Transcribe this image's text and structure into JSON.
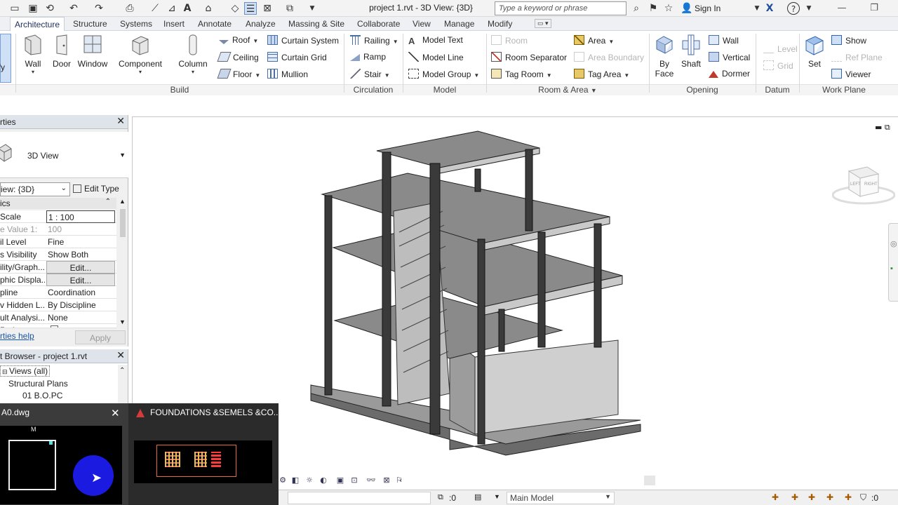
{
  "app": {
    "title": "project 1.rvt - 3D View: {3D}",
    "search_placeholder": "Type a keyword or phrase",
    "sign_in": "Sign In",
    "help": "?"
  },
  "ribbon_tabs": [
    {
      "label": "Architecture",
      "active": true
    },
    {
      "label": "Structure"
    },
    {
      "label": "Systems"
    },
    {
      "label": "Insert"
    },
    {
      "label": "Annotate"
    },
    {
      "label": "Analyze"
    },
    {
      "label": "Massing & Site"
    },
    {
      "label": "Collaborate"
    },
    {
      "label": "View"
    },
    {
      "label": "Manage"
    },
    {
      "label": "Modify"
    }
  ],
  "ribbon": {
    "modify": "ify",
    "build": {
      "title": "Build",
      "wall": "Wall",
      "door": "Door",
      "window": "Window",
      "component": "Component",
      "column": "Column",
      "roof": "Roof",
      "ceiling": "Ceiling",
      "floor": "Floor",
      "curtain_system": "Curtain System",
      "curtain_grid": "Curtain Grid",
      "mullion": "Mullion"
    },
    "circulation": {
      "title": "Circulation",
      "railing": "Railing",
      "ramp": "Ramp",
      "stair": "Stair"
    },
    "model": {
      "title": "Model",
      "model_text": "Model Text",
      "model_line": "Model Line",
      "model_group": "Model Group"
    },
    "room_area": {
      "title": "Room & Area",
      "room": "Room",
      "room_separator": "Room Separator",
      "tag_room": "Tag Room",
      "area": "Area",
      "area_boundary": "Area Boundary",
      "tag_area": "Tag Area"
    },
    "opening": {
      "title": "Opening",
      "by_face_1": "By",
      "by_face_2": "Face",
      "shaft": "Shaft",
      "wall": "Wall",
      "vertical": "Vertical",
      "dormer": "Dormer"
    },
    "datum": {
      "title": "Datum",
      "level": "Level",
      "grid": "Grid"
    },
    "work_plane": {
      "title": "Work Plane",
      "set": "Set",
      "show": "Show",
      "ref_plane": "Ref  Plane",
      "viewer": "Viewer"
    }
  },
  "properties": {
    "title": "rties",
    "type_name": "3D View",
    "view_selector": "iew: {3D}",
    "edit_type": "Edit Type",
    "group": "ics",
    "rows": [
      {
        "key": "Scale",
        "value": "1 : 100",
        "style": "boxed"
      },
      {
        "key": "e Value   1:",
        "value": "100",
        "style": "dim"
      },
      {
        "key": "il Level",
        "value": "Fine",
        "style": ""
      },
      {
        "key": "s Visibility",
        "value": "Show Both",
        "style": ""
      },
      {
        "key": "ility/Graph...",
        "value": "Edit...",
        "style": "btn"
      },
      {
        "key": "phic Displa...",
        "value": "Edit...",
        "style": "btn"
      },
      {
        "key": "pline",
        "value": "Coordination",
        "style": ""
      },
      {
        "key": "v Hidden L...",
        "value": "By Discipline",
        "style": ""
      },
      {
        "key": "ult Analysi...",
        "value": "None",
        "style": ""
      },
      {
        "key": "Path",
        "value": "",
        "style": "check"
      }
    ],
    "help_link": "rties help",
    "apply": "Apply"
  },
  "browser": {
    "title": "t Browser - project 1.rvt",
    "items": [
      "Views (all)",
      "Structural Plans",
      "01 B.O.PC"
    ]
  },
  "status_bar": {
    "worksets": ":0",
    "design_option": "Main Model",
    "filter_count": ":0"
  },
  "taskbar": {
    "thumb1_title": "A0.dwg",
    "thumb2_title": "FOUNDATIONS &SEMELS &CO..."
  },
  "viewcube": {
    "left": "LEFT",
    "right": "RIGHT"
  },
  "colors": {
    "accent": "#1f4e9c",
    "canvas_bg": "#ffffff",
    "model_dark": "#3a3a3a",
    "model_light": "#c8c8c8"
  }
}
